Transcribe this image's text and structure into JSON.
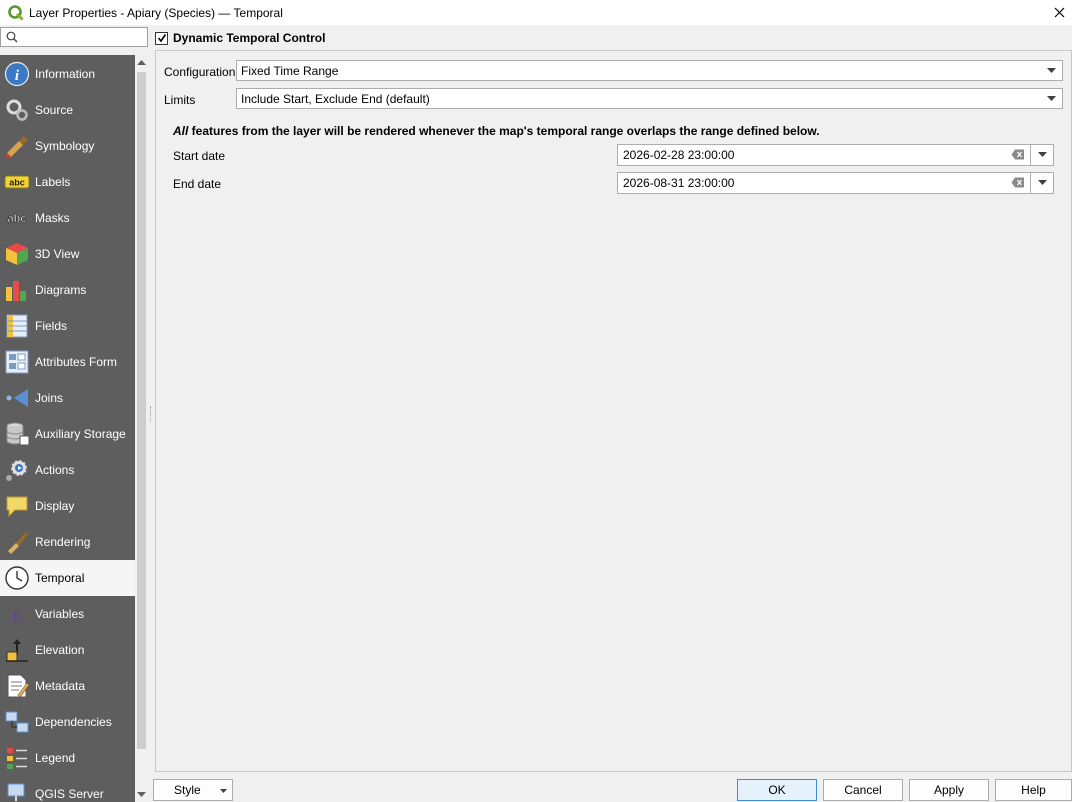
{
  "window": {
    "title": "Layer Properties - Apiary (Species) — Temporal",
    "close_icon": "close-icon"
  },
  "search": {
    "value": "",
    "placeholder": ""
  },
  "sidebar": {
    "items": [
      {
        "label": "Information",
        "icon": "information-icon"
      },
      {
        "label": "Source",
        "icon": "source-icon"
      },
      {
        "label": "Symbology",
        "icon": "symbology-icon"
      },
      {
        "label": "Labels",
        "icon": "labels-icon"
      },
      {
        "label": "Masks",
        "icon": "masks-icon"
      },
      {
        "label": "3D View",
        "icon": "3d-view-icon"
      },
      {
        "label": "Diagrams",
        "icon": "diagrams-icon"
      },
      {
        "label": "Fields",
        "icon": "fields-icon"
      },
      {
        "label": "Attributes Form",
        "icon": "attributes-form-icon"
      },
      {
        "label": "Joins",
        "icon": "joins-icon"
      },
      {
        "label": "Auxiliary Storage",
        "icon": "auxiliary-storage-icon"
      },
      {
        "label": "Actions",
        "icon": "actions-icon"
      },
      {
        "label": "Display",
        "icon": "display-icon"
      },
      {
        "label": "Rendering",
        "icon": "rendering-icon"
      },
      {
        "label": "Temporal",
        "icon": "temporal-icon"
      },
      {
        "label": "Variables",
        "icon": "variables-icon"
      },
      {
        "label": "Elevation",
        "icon": "elevation-icon"
      },
      {
        "label": "Metadata",
        "icon": "metadata-icon"
      },
      {
        "label": "Dependencies",
        "icon": "dependencies-icon"
      },
      {
        "label": "Legend",
        "icon": "legend-icon"
      },
      {
        "label": "QGIS Server",
        "icon": "qgis-server-icon"
      }
    ],
    "active": "Temporal"
  },
  "temporal": {
    "dynamic_control_label": "Dynamic Temporal Control",
    "dynamic_control_checked": true,
    "configuration_label": "Configuration",
    "configuration_value": "Fixed Time Range",
    "limits_label": "Limits",
    "limits_value": "Include Start, Exclude End (default)",
    "info_all": "All",
    "info_rest": " features from the layer will be rendered whenever the map's temporal range overlaps the range defined below.",
    "start_label": "Start date",
    "start_value": "2026-02-28 23:00:00",
    "end_label": "End date",
    "end_value": "2026-08-31 23:00:00"
  },
  "buttons": {
    "style": "Style",
    "ok": "OK",
    "cancel": "Cancel",
    "apply": "Apply",
    "help": "Help"
  },
  "colors": {
    "sidebar_bg": "#5e5e5e",
    "active_item_bg": "#f5f5f5",
    "default_button_border": "#3c8fd4"
  }
}
